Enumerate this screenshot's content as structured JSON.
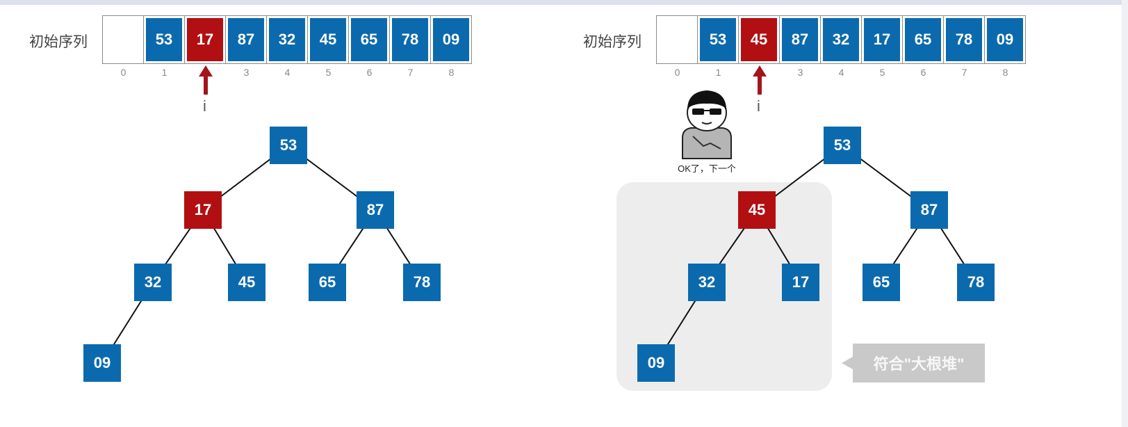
{
  "left": {
    "label": "初始序列",
    "array": [
      {
        "value": "",
        "color": "empty"
      },
      {
        "value": "53",
        "color": "blue"
      },
      {
        "value": "17",
        "color": "red"
      },
      {
        "value": "87",
        "color": "blue"
      },
      {
        "value": "32",
        "color": "blue"
      },
      {
        "value": "45",
        "color": "blue"
      },
      {
        "value": "65",
        "color": "blue"
      },
      {
        "value": "78",
        "color": "blue"
      },
      {
        "value": "09",
        "color": "blue"
      }
    ],
    "indices": [
      "0",
      "1",
      "2",
      "3",
      "4",
      "5",
      "6",
      "7",
      "8"
    ],
    "pointer_label": "i",
    "pointer_index": 2,
    "tree": [
      {
        "value": "53",
        "color": "blue"
      },
      {
        "value": "17",
        "color": "red"
      },
      {
        "value": "87",
        "color": "blue"
      },
      {
        "value": "32",
        "color": "blue"
      },
      {
        "value": "45",
        "color": "blue"
      },
      {
        "value": "65",
        "color": "blue"
      },
      {
        "value": "78",
        "color": "blue"
      },
      {
        "value": "09",
        "color": "blue"
      }
    ]
  },
  "right": {
    "label": "初始序列",
    "array": [
      {
        "value": "",
        "color": "empty"
      },
      {
        "value": "53",
        "color": "blue"
      },
      {
        "value": "45",
        "color": "red"
      },
      {
        "value": "87",
        "color": "blue"
      },
      {
        "value": "32",
        "color": "blue"
      },
      {
        "value": "17",
        "color": "blue"
      },
      {
        "value": "65",
        "color": "blue"
      },
      {
        "value": "78",
        "color": "blue"
      },
      {
        "value": "09",
        "color": "blue"
      }
    ],
    "indices": [
      "0",
      "1",
      "2",
      "3",
      "4",
      "5",
      "6",
      "7",
      "8"
    ],
    "pointer_label": "i",
    "pointer_index": 2,
    "tree": [
      {
        "value": "53",
        "color": "blue"
      },
      {
        "value": "45",
        "color": "red"
      },
      {
        "value": "87",
        "color": "blue"
      },
      {
        "value": "32",
        "color": "blue"
      },
      {
        "value": "17",
        "color": "blue"
      },
      {
        "value": "65",
        "color": "blue"
      },
      {
        "value": "78",
        "color": "blue"
      },
      {
        "value": "09",
        "color": "blue"
      }
    ],
    "callout": "符合\"大根堆\"",
    "meme_caption": "OK了，下一个"
  },
  "colors": {
    "blue": "#0b6aad",
    "red": "#b20f13",
    "arrow": "#a3151a"
  }
}
